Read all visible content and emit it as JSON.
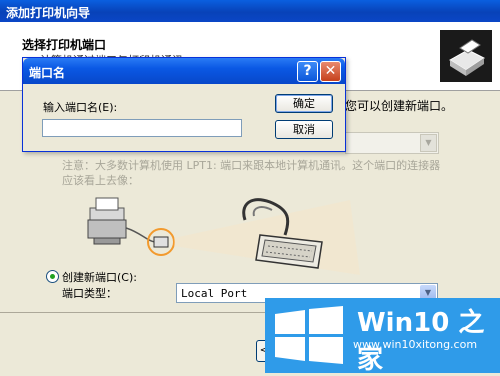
{
  "wizard": {
    "title": "添加打印机向导",
    "header_title": "选择打印机端口",
    "header_subtitle": "计算机通过端口与打印机通讯。",
    "right_text": "您可以创建新端口。",
    "note": "注意：大多数计算机使用 LPT1: 端口来跟本地计算机通讯。这个端口的连接器应该看上去像：",
    "create_port_label": "创建新端口(C):",
    "port_type_label": "端口类型：",
    "port_type_value": "Local Port",
    "back_label": "<"
  },
  "dialog": {
    "title": "端口名",
    "prompt": "输入端口名(E):",
    "input_value": "",
    "ok_label": "确定",
    "cancel_label": "取消",
    "help_glyph": "?",
    "close_glyph": "✕"
  },
  "watermark": {
    "title": "Win10 之家",
    "url": "www.win10xitong.com"
  },
  "colors": {
    "titlebar_blue": "#0A58E4",
    "close_red": "#C5401C",
    "watermark_blue": "#2F9BE9",
    "radio_green": "#21A121"
  }
}
